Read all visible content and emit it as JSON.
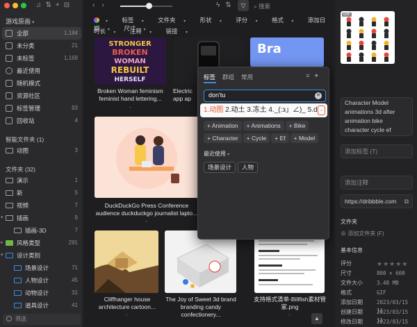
{
  "sidebar": {
    "library_title": "游戏原画",
    "items": [
      {
        "label": "全部",
        "count": "1,184"
      },
      {
        "label": "未分类",
        "count": "21"
      },
      {
        "label": "未标签",
        "count": "1,169"
      },
      {
        "label": "最近使用",
        "count": ""
      },
      {
        "label": "随机模式",
        "count": ""
      },
      {
        "label": "资源社区",
        "count": ""
      },
      {
        "label": "标签管理",
        "count": "93"
      },
      {
        "label": "回收站",
        "count": "4"
      }
    ],
    "smart_folders_title": "智能文件夹 (1)",
    "smart_folders": [
      {
        "label": "动图",
        "count": "3"
      }
    ],
    "folders_title": "文件夹 (32)",
    "folders": [
      {
        "label": "演示",
        "count": "1"
      },
      {
        "label": "新",
        "count": "5"
      },
      {
        "label": "视频",
        "count": "7"
      },
      {
        "label": "插画",
        "count": "9"
      },
      {
        "label": "插画-3D",
        "count": "7"
      },
      {
        "label": "风格类型",
        "count": "291"
      },
      {
        "label": "设计类别",
        "count": ""
      },
      {
        "label": "场景设计",
        "count": "71"
      },
      {
        "label": "人物设计",
        "count": "45"
      },
      {
        "label": "动物设计",
        "count": "31"
      },
      {
        "label": "道具设计",
        "count": "41"
      }
    ],
    "filter_placeholder": "筛选"
  },
  "toolbar": {
    "search_placeholder": "搜索",
    "filters_row1": [
      "标签",
      "文件夹",
      "形状",
      "评分",
      "格式",
      "添加日期",
      "尺寸"
    ],
    "filters_row2": [
      "时长",
      "注释",
      "链接"
    ],
    "zoom_level": 0.55
  },
  "grid": {
    "items": [
      {
        "caption": "Broken Woman feminism feminist hand lettering...",
        "sub": "-"
      },
      {
        "caption": "Electric app ap",
        "sub": ""
      },
      {
        "caption": "DuckDuckGo Press Conference audience duckduckgo journalist lapto...",
        "sub": "-"
      },
      {
        "caption": "Cliffhanger house architecture cartoon...",
        "sub": "-"
      },
      {
        "caption": "The Joy of Sweet 3d brand branding candy confectionery...",
        "sub": "-"
      },
      {
        "caption": "支持格式清单-Billfish素材管家.png",
        "sub": "-"
      }
    ],
    "top_thumb_texts": {
      "poster1": "STRONGER",
      "poster2": "BROKEN",
      "poster3": "WOMAN",
      "poster4": "REBUILT",
      "poster5": "HERSELF",
      "bracket": "Bra"
    }
  },
  "tag_popup": {
    "tabs": [
      "标签",
      "群组",
      "常用"
    ],
    "input_value": "don'tu",
    "ime_candidates": "1.动图  2.动土  3.冻土  4._(:з」∠)_  5.do",
    "ime_first": "1.动图",
    "suggestions": [
      "Animation",
      "Animations",
      "Bike",
      "Character",
      "Cycle",
      "Ef",
      "Model"
    ],
    "recent_title": "最近使用",
    "recent": [
      "场景设计",
      "人物"
    ]
  },
  "inspector": {
    "gif_badge": "GIF",
    "name": "Character Model animations 3d after animation bike character cycle ef",
    "add_tag_placeholder": "添加标签 (T)",
    "add_note_placeholder": "添加注释",
    "url": "https://dribbble.com",
    "folder_title": "文件夹",
    "add_folder": "添加文件夹 (F)",
    "info_title": "基本信息",
    "info": [
      {
        "k": "评分",
        "v": ""
      },
      {
        "k": "尺寸",
        "v": "800 × 600"
      },
      {
        "k": "文件大小",
        "v": "3.48 MB"
      },
      {
        "k": "格式",
        "v": "GIF"
      },
      {
        "k": "添加日期",
        "v": "2023/03/15 11"
      },
      {
        "k": "创建日期",
        "v": "2023/03/15 11"
      },
      {
        "k": "修改日期",
        "v": "2023/03/15 11"
      }
    ]
  },
  "colors": {
    "accent": "#3a8ee6",
    "ime_highlight": "#e8562a",
    "folder_green": "#6fb64a"
  }
}
